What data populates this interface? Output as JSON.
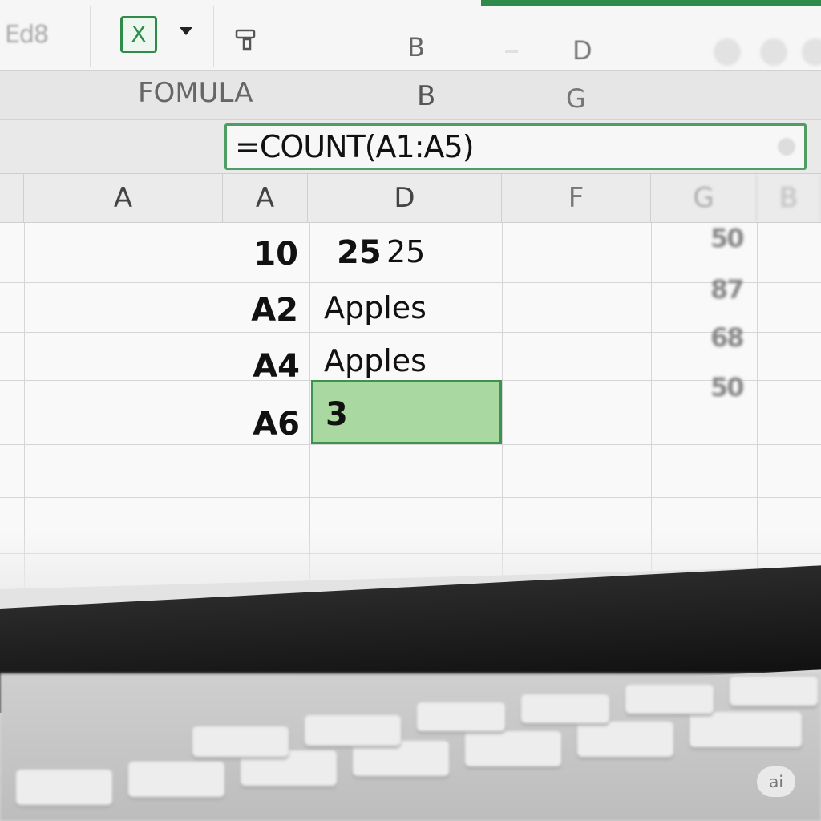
{
  "toolbar": {
    "edit_label": "Ed8",
    "excel_icon_glyph": "X",
    "letter_b": "B",
    "letter_d": "D"
  },
  "ribbon": {
    "formula_label": "FOMULA",
    "letter_b": "B",
    "letter_g": "G"
  },
  "formula_bar": {
    "value": "=COUNT(A1:A5)"
  },
  "columns": {
    "col1": "A",
    "col2": "A",
    "col3": "D",
    "col4": "F",
    "col5": "G",
    "col6": "B"
  },
  "rows": [
    {
      "col_a": "10",
      "col_d_bold": "25",
      "col_d": "25"
    },
    {
      "col_a": "A2",
      "col_d": "Apples"
    },
    {
      "col_a": "A4",
      "col_d": "Apples"
    },
    {
      "col_a": "A6",
      "col_d": "3"
    }
  ],
  "right_column_values": [
    "50",
    "87",
    "68",
    "50"
  ],
  "badge": "ai",
  "colors": {
    "accent_green": "#2e8b4a",
    "selection_fill": "#a9d8a0"
  }
}
